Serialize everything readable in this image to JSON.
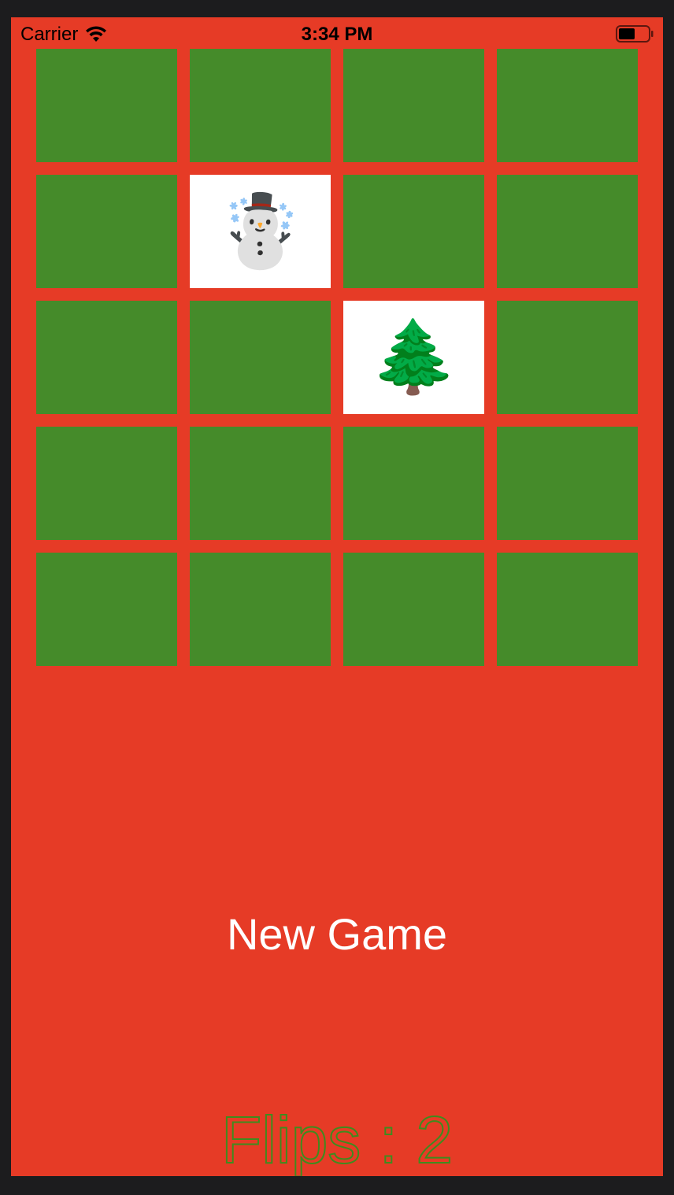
{
  "status_bar": {
    "carrier": "Carrier",
    "time": "3:34 PM",
    "wifi_icon": "wifi-icon",
    "battery_icon": "battery-icon"
  },
  "colors": {
    "background": "#e63b26",
    "card_back": "#458b2a",
    "card_face": "#ffffff",
    "flips_text": "#3f8b1e",
    "button_text": "#ffffff"
  },
  "cards": [
    {
      "state": "face-down",
      "content": ""
    },
    {
      "state": "face-down",
      "content": ""
    },
    {
      "state": "face-down",
      "content": ""
    },
    {
      "state": "face-down",
      "content": ""
    },
    {
      "state": "face-down",
      "content": ""
    },
    {
      "state": "face-up",
      "content": "☃️",
      "icon": "snowman-icon"
    },
    {
      "state": "face-down",
      "content": ""
    },
    {
      "state": "face-down",
      "content": ""
    },
    {
      "state": "face-down",
      "content": ""
    },
    {
      "state": "face-down",
      "content": ""
    },
    {
      "state": "face-up",
      "content": "🌲",
      "icon": "christmas-tree-icon"
    },
    {
      "state": "face-down",
      "content": ""
    },
    {
      "state": "face-down",
      "content": ""
    },
    {
      "state": "face-down",
      "content": ""
    },
    {
      "state": "face-down",
      "content": ""
    },
    {
      "state": "face-down",
      "content": ""
    },
    {
      "state": "face-down",
      "content": ""
    },
    {
      "state": "face-down",
      "content": ""
    },
    {
      "state": "face-down",
      "content": ""
    },
    {
      "state": "face-down",
      "content": ""
    }
  ],
  "new_game_label": "New Game",
  "flips_label": "Flips : 2"
}
